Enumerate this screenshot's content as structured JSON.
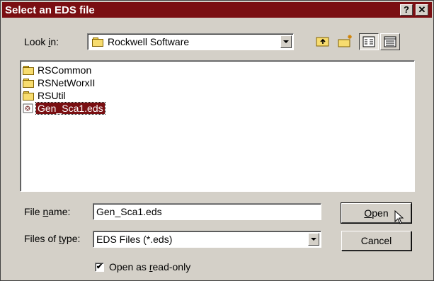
{
  "dialog": {
    "title": "Select an EDS file",
    "help_label": "?",
    "close_label": "✕"
  },
  "look_in": {
    "label_pre": "Look ",
    "label_accel": "i",
    "label_post": "n:",
    "value": "Rockwell Software"
  },
  "toolbar": {
    "icons": [
      "up-one-level-icon",
      "create-new-folder-icon",
      "list-view-icon",
      "details-view-icon"
    ]
  },
  "files": [
    {
      "name": "RSCommon",
      "type": "folder"
    },
    {
      "name": "RSNetWorxII",
      "type": "folder"
    },
    {
      "name": "RSUtil",
      "type": "folder"
    },
    {
      "name": "Gen_Sca1.eds",
      "type": "file",
      "selected": true
    }
  ],
  "file_name": {
    "label_pre": "File ",
    "label_accel": "n",
    "label_post": "ame:",
    "value": "Gen_Sca1.eds"
  },
  "file_type": {
    "label_pre": "Files of ",
    "label_accel": "t",
    "label_post": "ype:",
    "value": "EDS Files (*.eds)"
  },
  "buttons": {
    "open_accel": "O",
    "open_rest": "pen",
    "cancel": "Cancel"
  },
  "readonly": {
    "checked": true,
    "check_glyph": "✔",
    "label_pre": "Open as ",
    "label_accel": "r",
    "label_post": "ead-only"
  },
  "colors": {
    "titlebar": "#7a0f12",
    "selection": "#7a0f12",
    "face": "#d4d0c8"
  }
}
